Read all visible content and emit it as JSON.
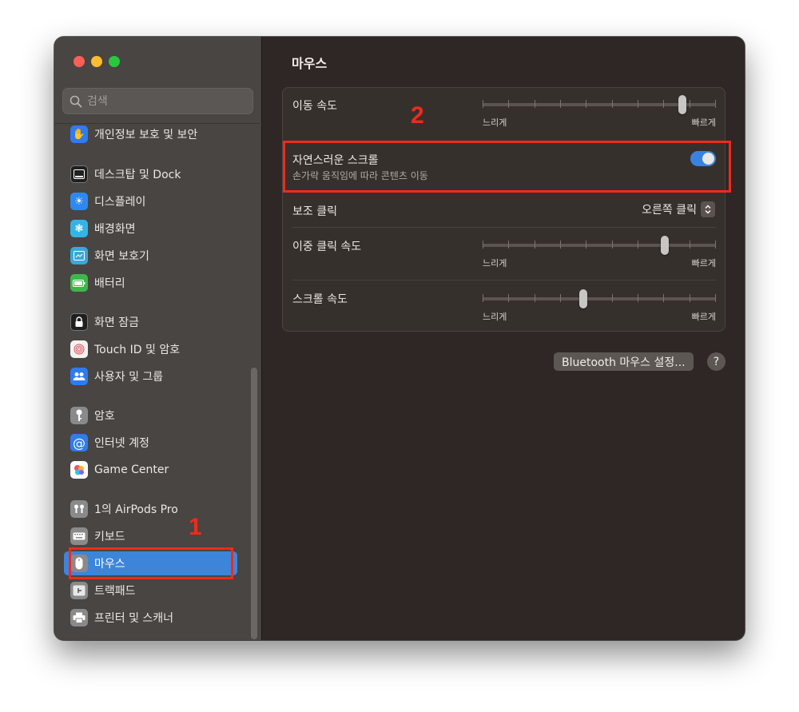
{
  "window": {
    "title": "마우스"
  },
  "sidebar": {
    "search_placeholder": "검색",
    "items": [
      {
        "label": "개인정보 보호 및 보안",
        "icon": "hand-icon",
        "color": "#2f7bf0"
      },
      {
        "label": "데스크탑 및 Dock",
        "icon": "dock-icon",
        "color": "#1f1f1f"
      },
      {
        "label": "디스플레이",
        "icon": "sun-icon",
        "color": "#2f88f0"
      },
      {
        "label": "배경화면",
        "icon": "flower-icon",
        "color": "#34b4e6"
      },
      {
        "label": "화면 보호기",
        "icon": "screensaver-icon",
        "color": "#3aa7d8"
      },
      {
        "label": "배터리",
        "icon": "battery-icon",
        "color": "#3cb84a"
      },
      {
        "label": "화면 잠금",
        "icon": "lock-icon",
        "color": "#1f1f1f"
      },
      {
        "label": "Touch ID 및 암호",
        "icon": "fingerprint-icon",
        "color": "#f2f2f2"
      },
      {
        "label": "사용자 및 그룹",
        "icon": "users-icon",
        "color": "#2f7bf0"
      },
      {
        "label": "암호",
        "icon": "key-icon",
        "color": "#8a8a8a"
      },
      {
        "label": "인터넷 계정",
        "icon": "at-icon",
        "color": "#2f7bf0"
      },
      {
        "label": "Game Center",
        "icon": "game-center-icon",
        "color": "#ffffff"
      },
      {
        "label": "1의 AirPods Pro",
        "icon": "airpods-icon",
        "color": "#8a8a8a"
      },
      {
        "label": "키보드",
        "icon": "keyboard-icon",
        "color": "#8a8a8a"
      },
      {
        "label": "마우스",
        "icon": "mouse-icon",
        "color": "#8a8a8a",
        "active": true
      },
      {
        "label": "트랙패드",
        "icon": "trackpad-icon",
        "color": "#8a8a8a"
      },
      {
        "label": "프린터 및 스캐너",
        "icon": "printer-icon",
        "color": "#8a8a8a"
      }
    ]
  },
  "main": {
    "tracking_speed": {
      "label": "이동 속도",
      "value": 0.87,
      "min_label": "느리게",
      "max_label": "빠르게"
    },
    "natural_scroll": {
      "label": "자연스러운 스크롤",
      "description": "손가락 움직임에 따라 콘텐츠 이동",
      "enabled": true
    },
    "secondary_click": {
      "label": "보조 클릭",
      "value": "오른쪽 클릭"
    },
    "double_click_speed": {
      "label": "이중 클릭 속도",
      "value": 0.79,
      "min_label": "느리게",
      "max_label": "빠르게"
    },
    "scroll_speed": {
      "label": "스크롤 속도",
      "value": 0.43,
      "min_label": "느리게",
      "max_label": "빠르게"
    },
    "bluetooth_button": "Bluetooth 마우스 설정...",
    "help_button": "?"
  },
  "annotations": [
    {
      "number": "1",
      "color": "#ee2b1b"
    },
    {
      "number": "2",
      "color": "#ee2b1b"
    }
  ]
}
